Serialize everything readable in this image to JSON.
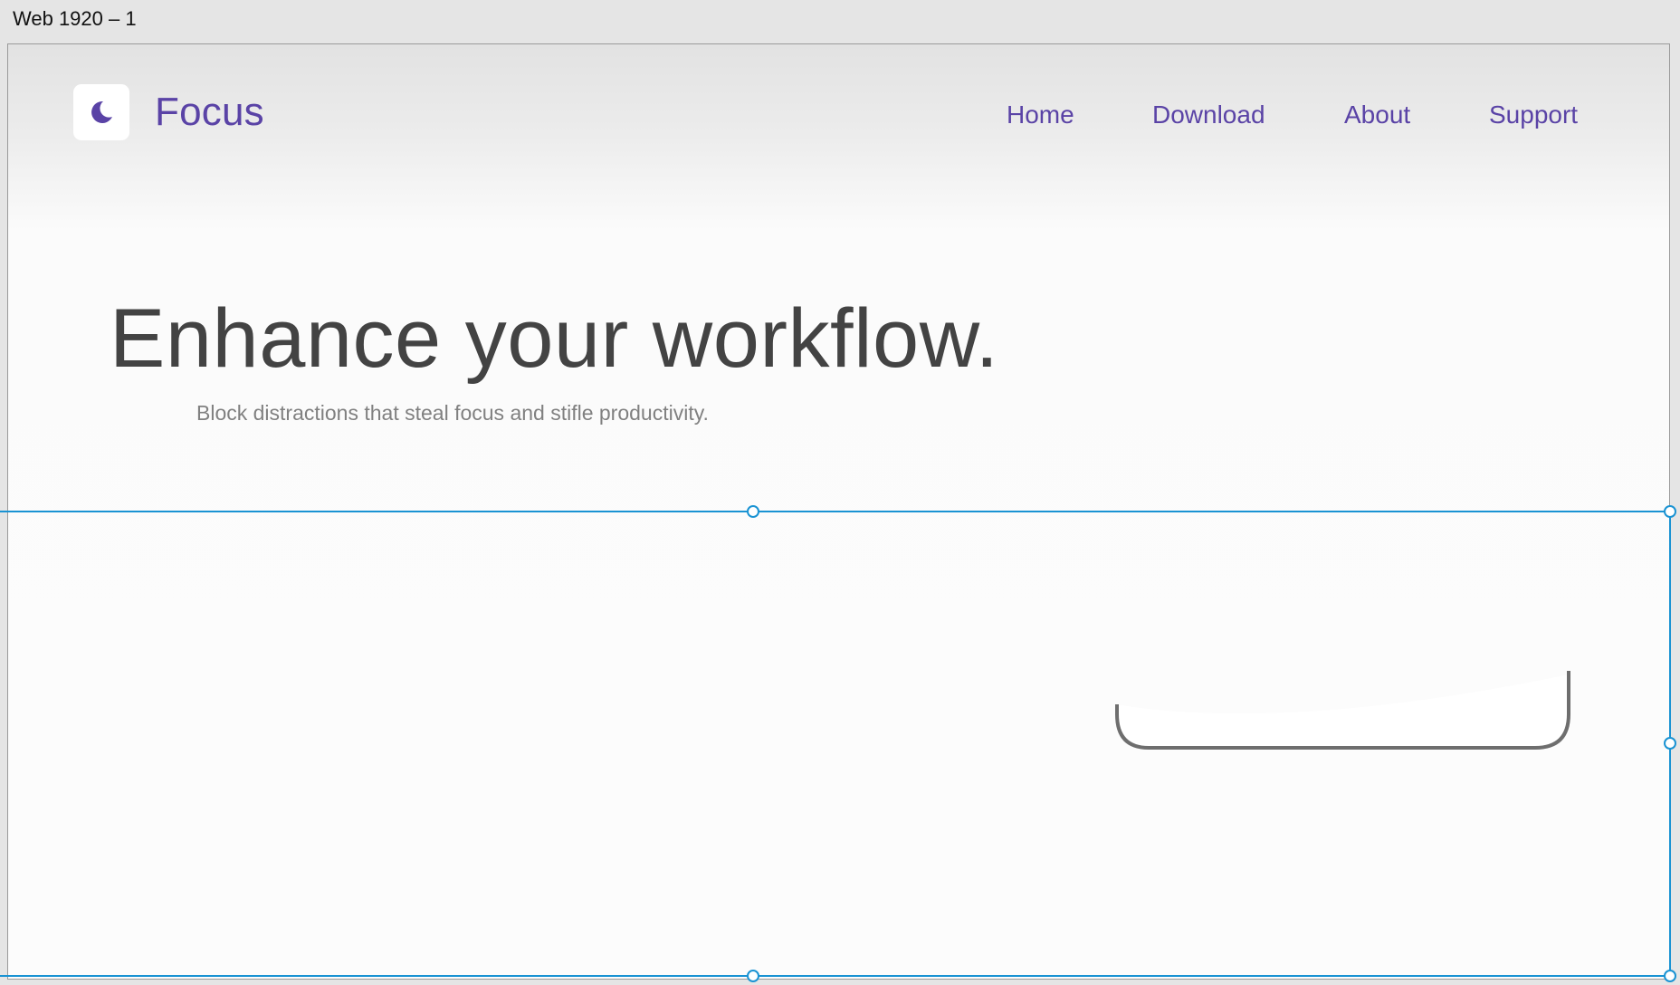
{
  "canvas": {
    "artboard_label": "Web 1920 – 1"
  },
  "header": {
    "logo_icon": "crescent-moon-icon",
    "brand_name": "Focus",
    "nav": [
      {
        "label": "Home"
      },
      {
        "label": "Download"
      },
      {
        "label": "About"
      },
      {
        "label": "Support"
      }
    ]
  },
  "hero": {
    "title": "Enhance your workflow.",
    "subtitle": "Block distractions that steal focus and stifle productivity."
  },
  "colors": {
    "brand_purple": "#5a43a6",
    "heading_gray": "#434343",
    "subtitle_gray": "#808080",
    "selection_blue": "#1a93d3",
    "device_outline": "#6e6e6e"
  }
}
